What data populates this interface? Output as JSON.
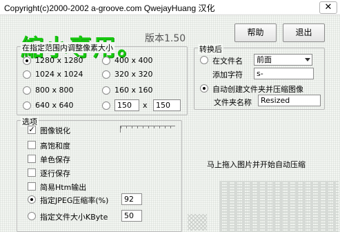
{
  "window": {
    "title": "Copyright(c)2000-2002 a-groove.com QwejayHuang 汉化",
    "close_glyph": "✕"
  },
  "app": {
    "logo": "縮小専用。",
    "version": "版本1.50",
    "help_button": "帮助",
    "exit_button": "退出"
  },
  "resize_group": {
    "title": "在指定范围内调整像素大小",
    "options": [
      {
        "label": "1280 x 1280",
        "checked": true
      },
      {
        "label": "400 x 400",
        "checked": false
      },
      {
        "label": "1024 x 1024",
        "checked": false
      },
      {
        "label": "320 x 320",
        "checked": false
      },
      {
        "label": "800 x 800",
        "checked": false
      },
      {
        "label": "160 x 160",
        "checked": false
      },
      {
        "label": "640 x 640",
        "checked": false
      }
    ],
    "custom_width": "150",
    "custom_x": "x",
    "custom_height": "150"
  },
  "convert_group": {
    "title": "转换后",
    "in_filename_label": "在文件名",
    "position_value": "前面",
    "add_char_label": "添加字符",
    "add_char_value": "s-",
    "auto_folder_label": "自动创建文件夹并压缩图像",
    "folder_name_label": "文件夹名称",
    "folder_name_value": "Resized"
  },
  "options_group": {
    "title": "选项",
    "sharpen": "图像锐化",
    "saturation": "高饱和度",
    "mono": "单色保存",
    "progressive": "逐行保存",
    "simple_html": "简易Htm输出",
    "jpeg_quality_label": "指定JPEG压缩率(%)",
    "jpeg_quality_value": "92",
    "filesize_label": "指定文件大小KByte",
    "filesize_value": "50"
  },
  "drop_message": "马上拖入图片并开始自动压缩",
  "colors": {
    "logo_green": "#15c90e",
    "client_bg": "#f3f6f2"
  }
}
